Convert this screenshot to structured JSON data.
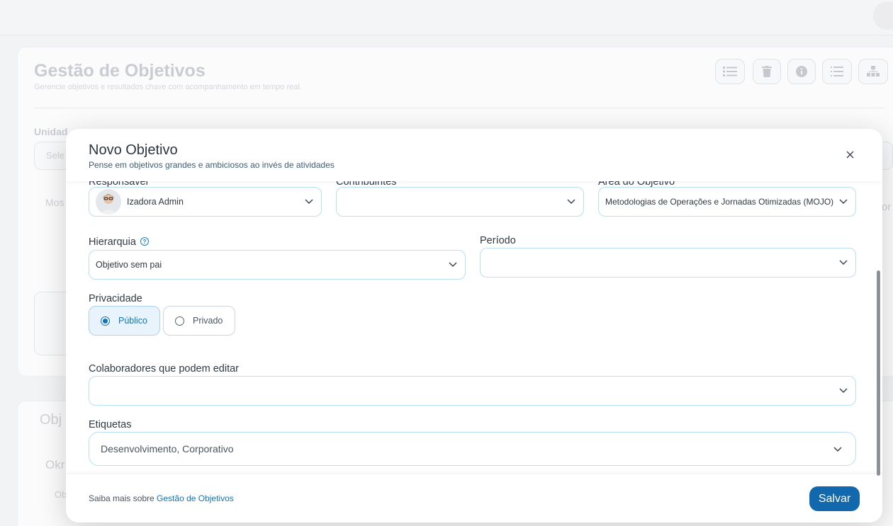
{
  "background": {
    "page_title": "Gestão de Objetivos",
    "page_subtitle": "Gerencie objetivos e resultados chave com acompanhamento em tempo real.",
    "filter_label": "Unidad",
    "select_placeholder": "Sele",
    "mos_text": "Mos",
    "section_title": "Obj",
    "okr_text": "Okr",
    "ob_text": "Ob",
    "right_text": "or"
  },
  "modal": {
    "title": "Novo Objetivo",
    "subtitle": "Pense em objetivos grandes e ambiciosos ao invés de atividades",
    "fields": {
      "responsavel": {
        "label": "Responsável",
        "value": "Izadora Admin"
      },
      "contribuintes": {
        "label": "Contribuintes",
        "value": ""
      },
      "area": {
        "label": "Área do Objetivo",
        "value": "Metodologias de Operações e Jornadas Otimizadas (MOJO)"
      },
      "hierarquia": {
        "label": "Hierarquia",
        "value": "Objetivo sem pai"
      },
      "periodo": {
        "label": "Período",
        "value": ""
      },
      "privacidade": {
        "label": "Privacidade",
        "options": [
          "Público",
          "Privado"
        ],
        "selected": "Público"
      },
      "colaboradores": {
        "label": "Colaboradores que podem editar",
        "value": ""
      },
      "etiquetas": {
        "label": "Etiquetas",
        "value": "Desenvolvimento, Corporativo"
      }
    },
    "footer": {
      "prefix": "Saiba mais sobre ",
      "link": "Gestão de Objetivos",
      "save_label": "Salvar"
    }
  },
  "colors": {
    "accent": "#1168ac",
    "field_border": "#b9dff2",
    "selected_bg": "#e8f3fb"
  }
}
